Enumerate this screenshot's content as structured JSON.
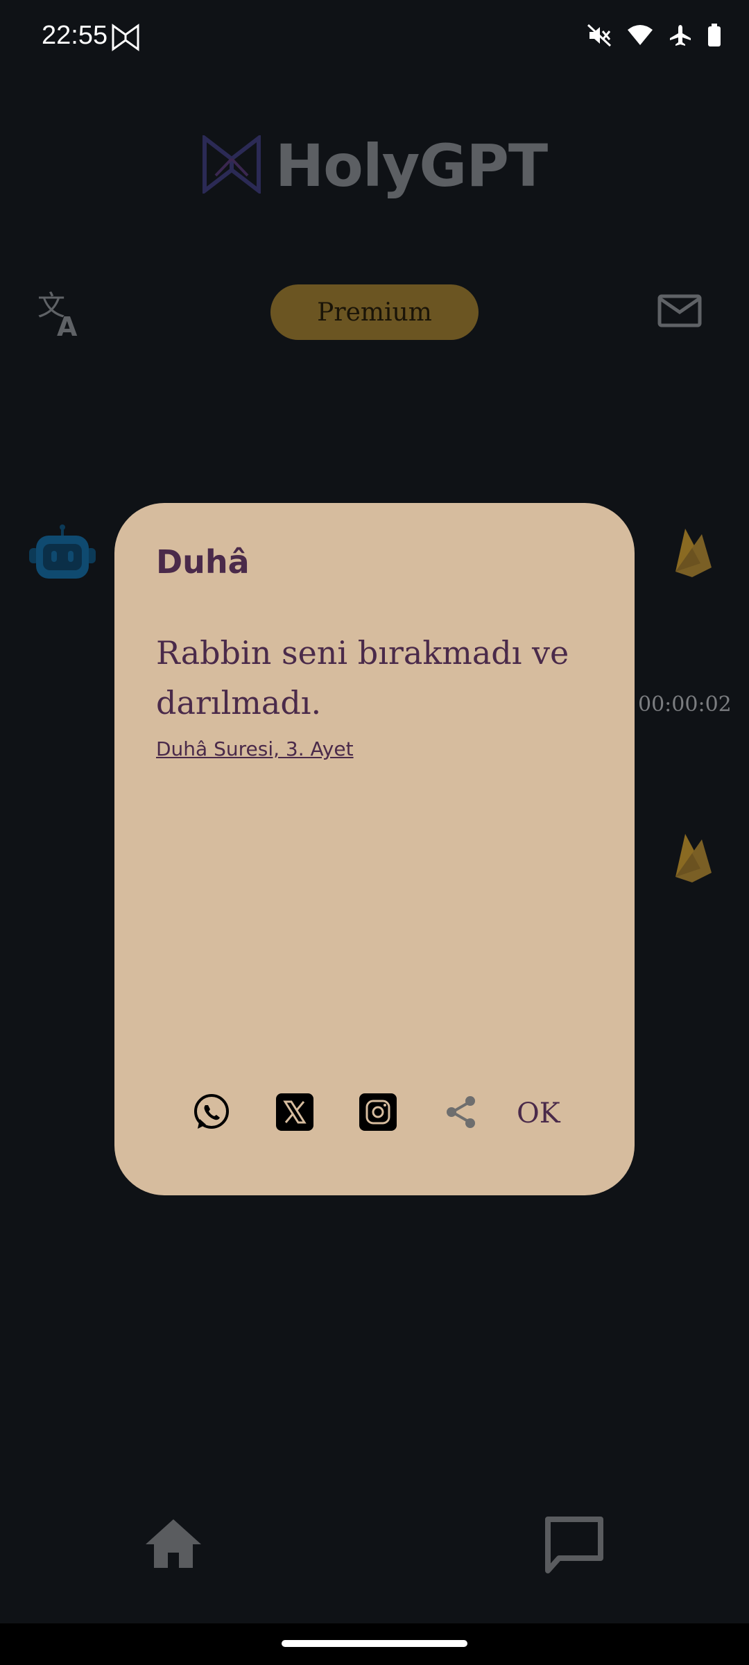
{
  "status_bar": {
    "time": "22:55",
    "icons": [
      "muted-icon",
      "wifi-icon",
      "airplane-icon",
      "battery-icon"
    ]
  },
  "header": {
    "app_name": "HolyGPT",
    "premium_label": "Premium"
  },
  "chat": {
    "timer": "00:00:02"
  },
  "dialog": {
    "title": "Duhâ",
    "verse": "Rabbin seni bırakmadı ve darılmadı.",
    "reference": "Duhâ Suresi, 3. Ayet",
    "share_targets": [
      "whatsapp",
      "x",
      "instagram",
      "share"
    ],
    "ok_label": "OK"
  },
  "colors": {
    "background": "#0f1216",
    "dialog": "#d6bc9e",
    "dialog_text": "#4a2a4a",
    "premium": "#6b5522",
    "accent_gold": "#7a5f25"
  }
}
